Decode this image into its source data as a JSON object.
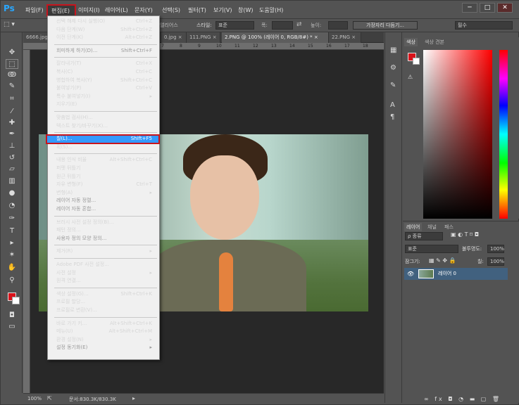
{
  "app": {
    "logo": "Ps",
    "menu": [
      "파일(F)",
      "편집(E)",
      "이미지(I)",
      "레이어(L)",
      "문자(Y)",
      "선택(S)",
      "필터(T)",
      "보기(V)",
      "창(W)",
      "도움말(H)"
    ],
    "window_controls": [
      "─",
      "□",
      "✕"
    ]
  },
  "options_bar": {
    "anti_alias": "앨리어스",
    "style_label": "스타일:",
    "style_value": "표준",
    "width_label": "폭:",
    "height_label": "높이:",
    "refine_button": "가장자리 다듬기...",
    "workspace": "필수"
  },
  "tabs": [
    "6666.jpg",
    "0.jpg ×",
    "111.PNG ×",
    "2.PNG @ 100% (레이어 0, RGB/8#) * ×",
    "22.PNG ×"
  ],
  "ruler_ticks": [
    "7",
    "8",
    "9",
    "10",
    "11",
    "12",
    "13",
    "14",
    "15",
    "16",
    "17",
    "18"
  ],
  "status": {
    "zoom": "100%",
    "doc_size": "문서:830.3K/830.3K"
  },
  "color_panel": {
    "tabs": [
      "색상",
      "색상 견본"
    ]
  },
  "layers_panel": {
    "tabs": [
      "레이어",
      "채널",
      "패스"
    ],
    "filter": "ρ 종류",
    "blend_mode": "표준",
    "opacity_label": "불투명도:",
    "opacity_value": "100%",
    "lock_label": "잠그기:",
    "fill_label": "칠:",
    "fill_value": "100%",
    "layer_name": "레이어 0"
  },
  "edit_menu": {
    "groups": [
      [
        {
          "label": "선택 해제 다시 실행(O)",
          "shortcut": "Ctrl+Z",
          "disabled": false
        },
        {
          "label": "다음 단계(W)",
          "shortcut": "Shift+Ctrl+Z",
          "disabled": false
        },
        {
          "label": "이전 단계(K)",
          "shortcut": "Alt+Ctrl+Z",
          "disabled": false
        }
      ],
      [
        {
          "label": "희미하게 하기(D)...",
          "shortcut": "Shift+Ctrl+F",
          "disabled": true
        }
      ],
      [
        {
          "label": "잘라내기(T)",
          "shortcut": "Ctrl+X",
          "disabled": false
        },
        {
          "label": "복사(C)",
          "shortcut": "Ctrl+C",
          "disabled": false
        },
        {
          "label": "병합하여 복사(Y)",
          "shortcut": "Shift+Ctrl+C",
          "disabled": false
        },
        {
          "label": "붙여넣기(P)",
          "shortcut": "Ctrl+V",
          "disabled": false
        },
        {
          "label": "특수 붙여넣기(I)",
          "shortcut": "▸",
          "disabled": false
        },
        {
          "label": "지우기(E)",
          "shortcut": "",
          "disabled": false
        }
      ],
      [
        {
          "label": "맞춤법 검사(H)...",
          "shortcut": "",
          "disabled": false
        },
        {
          "label": "텍스트 찾기/바꾸기(X)...",
          "shortcut": "",
          "disabled": false
        }
      ],
      [
        {
          "label": "칠(L)...",
          "shortcut": "Shift+F5",
          "disabled": false
        },
        {
          "label": "획(S)...",
          "shortcut": "",
          "disabled": false
        }
      ],
      [
        {
          "label": "내용 인식 비율",
          "shortcut": "Alt+Shift+Ctrl+C",
          "disabled": false
        },
        {
          "label": "퍼펫 뒤틀기",
          "shortcut": "",
          "disabled": false
        },
        {
          "label": "원근 뒤틀기",
          "shortcut": "",
          "disabled": false
        },
        {
          "label": "자유 변형(F)",
          "shortcut": "Ctrl+T",
          "disabled": false
        },
        {
          "label": "변형(A)",
          "shortcut": "▸",
          "disabled": false
        },
        {
          "label": "레이어 자동 정렬...",
          "shortcut": "",
          "disabled": true
        },
        {
          "label": "레이어 자동 혼합...",
          "shortcut": "",
          "disabled": true
        }
      ],
      [
        {
          "label": "브러시 사전 설정 정의(B)...",
          "shortcut": "",
          "disabled": false
        },
        {
          "label": "패턴 정의...",
          "shortcut": "",
          "disabled": false
        },
        {
          "label": "사용자 정의 모양 정의...",
          "shortcut": "",
          "disabled": true
        }
      ],
      [
        {
          "label": "제거(R)",
          "shortcut": "▸",
          "disabled": false
        }
      ],
      [
        {
          "label": "Adobe PDF 사전 설정...",
          "shortcut": "",
          "disabled": false
        },
        {
          "label": "사전 설정",
          "shortcut": "▸",
          "disabled": false
        },
        {
          "label": "원격 연결...",
          "shortcut": "",
          "disabled": false
        }
      ],
      [
        {
          "label": "색상 설정(G)...",
          "shortcut": "Shift+Ctrl+K",
          "disabled": false
        },
        {
          "label": "프로필 할당...",
          "shortcut": "",
          "disabled": false
        },
        {
          "label": "프로필로 변환(V)...",
          "shortcut": "",
          "disabled": false
        }
      ],
      [
        {
          "label": "바로 가기 키...",
          "shortcut": "Alt+Shift+Ctrl+K",
          "disabled": false
        },
        {
          "label": "메뉴(U)",
          "shortcut": "Alt+Shift+Ctrl+M",
          "disabled": false
        },
        {
          "label": "환경 설정(N)",
          "shortcut": "▸",
          "disabled": false
        },
        {
          "label": "설정 동기화(E)",
          "shortcut": "▸",
          "disabled": true
        }
      ]
    ],
    "highlighted": "칠(L)..."
  }
}
